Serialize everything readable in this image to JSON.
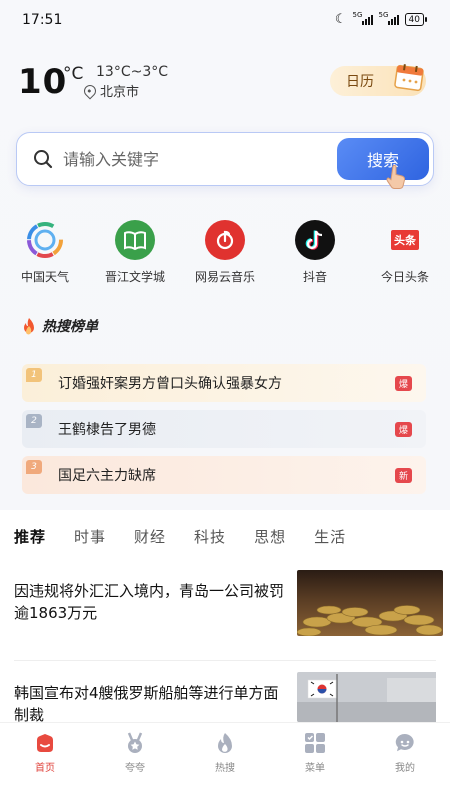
{
  "status": {
    "time": "17:51",
    "net1": "5G",
    "net2": "5G",
    "battery": "40"
  },
  "weather": {
    "temp": "10",
    "unit": "°C",
    "range": "13°C~3°C",
    "city": "北京市"
  },
  "calendar": {
    "label": "日历"
  },
  "search": {
    "placeholder": "请输入关键字",
    "button": "搜索"
  },
  "apps": [
    {
      "label": "中国天气",
      "icon": "pinwheel-icon"
    },
    {
      "label": "晋江文学城",
      "icon": "book-icon"
    },
    {
      "label": "网易云音乐",
      "icon": "music-icon"
    },
    {
      "label": "抖音",
      "icon": "note-icon"
    },
    {
      "label": "今日头条",
      "icon": "toutiao-icon",
      "logo_text": "头条"
    }
  ],
  "hot": {
    "title": "热搜榜单",
    "items": [
      {
        "rank": "1",
        "text": "订婚强奸案男方曾口头确认强暴女方",
        "tag": "爆"
      },
      {
        "rank": "2",
        "text": "王鹤棣告了男德",
        "tag": "爆"
      },
      {
        "rank": "3",
        "text": "国足六主力缺席",
        "tag": "新"
      }
    ]
  },
  "tabs": [
    "推荐",
    "时事",
    "财经",
    "科技",
    "思想",
    "生活"
  ],
  "news": [
    {
      "title": "因违规将外汇汇入境内，青岛一公司被罚逾1863万元"
    },
    {
      "title": "韩国宣布对4艘俄罗斯船舶等进行单方面制裁"
    }
  ],
  "nav": [
    {
      "label": "首页",
      "icon": "home-icon"
    },
    {
      "label": "夸夸",
      "icon": "medal-icon"
    },
    {
      "label": "热搜",
      "icon": "flame-icon"
    },
    {
      "label": "菜单",
      "icon": "grid-icon"
    },
    {
      "label": "我的",
      "icon": "chat-icon"
    }
  ],
  "colors": {
    "accent": "#2f64e0",
    "nav_active": "#e0433c",
    "hot_tag": "#e5484d"
  }
}
